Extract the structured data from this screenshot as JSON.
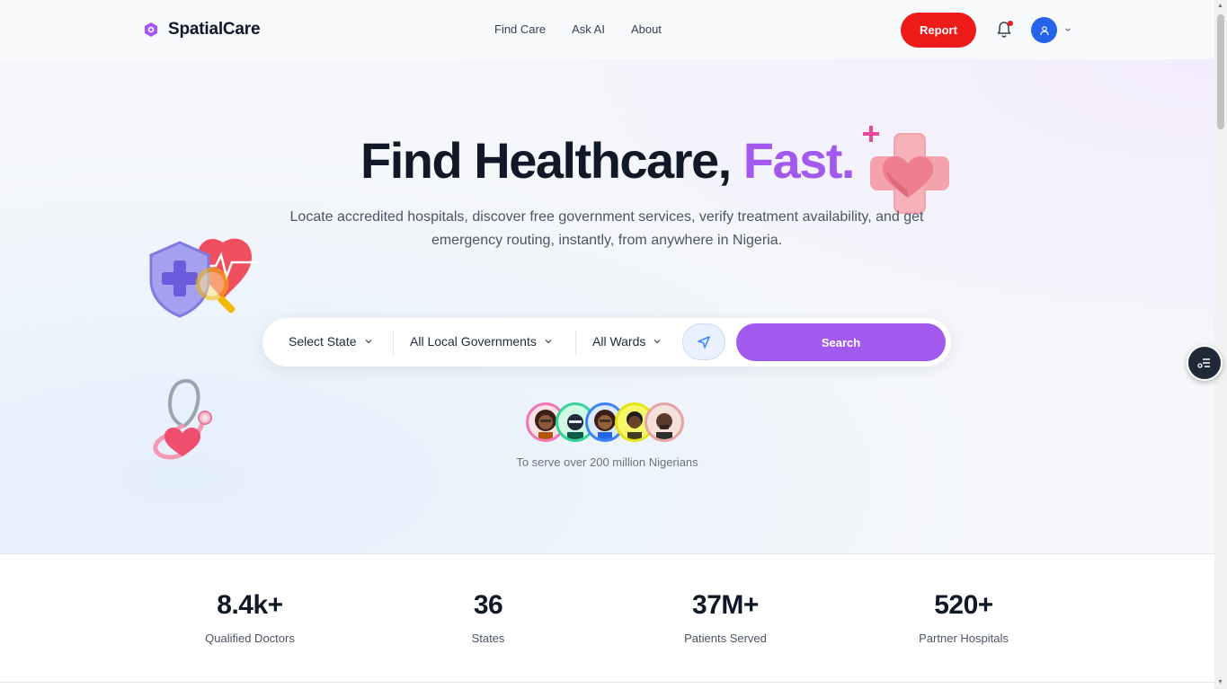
{
  "header": {
    "brand": "SpatialCare",
    "nav": [
      "Find Care",
      "Ask AI",
      "About"
    ],
    "report_label": "Report"
  },
  "hero": {
    "title_main": "Find Healthcare,",
    "title_accent": "Fast.",
    "subtitle": "Locate accredited hospitals, discover free government services, verify treatment availability, and get emergency routing, instantly, from anywhere in Nigeria."
  },
  "search": {
    "state": "Select State",
    "lga": "All Local Governments",
    "ward": "All Wards",
    "button": "Search"
  },
  "community": {
    "tagline": "To serve over 200 million Nigerians"
  },
  "stats": [
    {
      "value": "8.4k+",
      "label": "Qualified Doctors"
    },
    {
      "value": "36",
      "label": "States"
    },
    {
      "value": "37M+",
      "label": "Patients Served"
    },
    {
      "value": "520+",
      "label": "Partner Hospitals"
    }
  ],
  "colors": {
    "brand_purple": "#a259ee",
    "report_red": "#ef1b1b",
    "avatar_blue": "#2563eb"
  },
  "icons": [
    "hexagon-logo-icon",
    "bell-icon",
    "user-icon",
    "chevron-down-icon",
    "navigation-arrow-icon",
    "menu-list-icon"
  ]
}
